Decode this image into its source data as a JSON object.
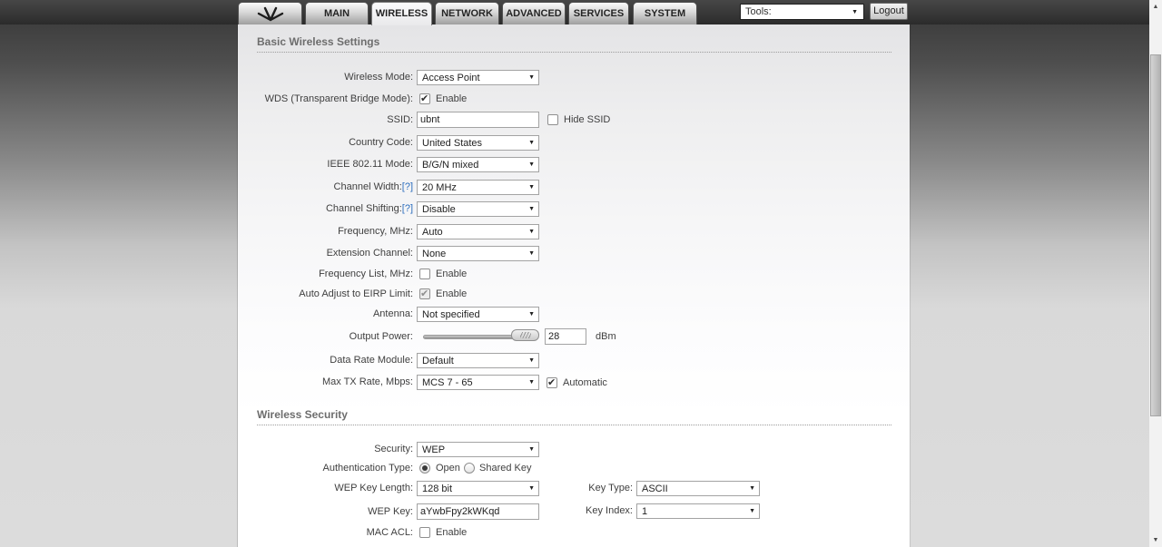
{
  "colors": {
    "help_link": "#2e6fbe",
    "header_bar": "#2b2b2b",
    "page_bg_bottom": "#dcdcdc"
  },
  "header": {
    "tabs": [
      "MAIN",
      "WIRELESS",
      "NETWORK",
      "ADVANCED",
      "SERVICES",
      "SYSTEM"
    ],
    "active_tab": "WIRELESS",
    "logo_icon": "ubnt-antenna",
    "tools_label": "Tools:",
    "logout_label": "Logout"
  },
  "basic": {
    "title": "Basic Wireless Settings",
    "wireless_mode": {
      "label": "Wireless Mode:",
      "value": "Access Point"
    },
    "wds": {
      "label": "WDS (Transparent Bridge Mode):",
      "checkbox": "Enable",
      "checked": true
    },
    "ssid": {
      "label": "SSID:",
      "value": "ubnt",
      "hide_label": "Hide SSID",
      "hide_checked": false
    },
    "country_code": {
      "label": "Country Code:",
      "value": "United States"
    },
    "ieee_mode": {
      "label": "IEEE 802.11 Mode:",
      "value": "B/G/N mixed"
    },
    "channel_width": {
      "label": "Channel Width:",
      "help": "[?]",
      "value": "20 MHz"
    },
    "channel_shifting": {
      "label": "Channel Shifting:",
      "help": "[?]",
      "value": "Disable"
    },
    "frequency": {
      "label": "Frequency, MHz:",
      "value": "Auto"
    },
    "extension_channel": {
      "label": "Extension Channel:",
      "value": "None"
    },
    "frequency_list": {
      "label": "Frequency List, MHz:",
      "checkbox": "Enable",
      "checked": false
    },
    "eirp_limit": {
      "label": "Auto Adjust to EIRP Limit:",
      "checkbox": "Enable",
      "checked": true,
      "disabled": true
    },
    "antenna": {
      "label": "Antenna:",
      "value": "Not specified"
    },
    "output_power": {
      "label": "Output Power:",
      "value": "28",
      "unit": "dBm",
      "slider_percent": 100
    },
    "data_rate_module": {
      "label": "Data Rate Module:",
      "value": "Default"
    },
    "max_tx_rate": {
      "label": "Max TX Rate, Mbps:",
      "value": "MCS 7 - 65",
      "checkbox": "Automatic",
      "checked": true
    }
  },
  "security": {
    "title": "Wireless Security",
    "security": {
      "label": "Security:",
      "value": "WEP"
    },
    "auth_type": {
      "label": "Authentication Type:",
      "options": [
        "Open",
        "Shared Key"
      ],
      "selected": "Open"
    },
    "wep_key_length": {
      "label": "WEP Key Length:",
      "value": "128 bit"
    },
    "key_type": {
      "label": "Key Type:",
      "value": "ASCII"
    },
    "wep_key": {
      "label": "WEP Key:",
      "value": "aYwbFpy2kWKqd"
    },
    "key_index": {
      "label": "Key Index:",
      "value": "1"
    },
    "mac_acl": {
      "label": "MAC ACL:",
      "checkbox": "Enable",
      "checked": false
    }
  }
}
